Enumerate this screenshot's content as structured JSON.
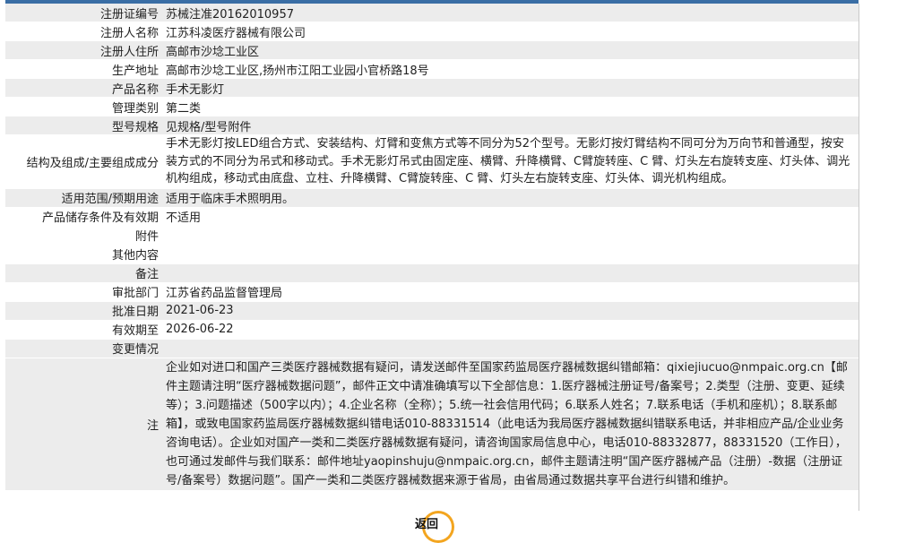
{
  "rows": [
    {
      "label": "注册证编号",
      "value": "苏械注准20162010957"
    },
    {
      "label": "注册人名称",
      "value": "江苏科凌医疗器械有限公司"
    },
    {
      "label": "注册人住所",
      "value": "高邮市沙埝工业区"
    },
    {
      "label": "生产地址",
      "value": "高邮市沙埝工业区,扬州市江阳工业园小官桥路18号"
    },
    {
      "label": "产品名称",
      "value": "手术无影灯"
    },
    {
      "label": "管理类别",
      "value": "第二类"
    },
    {
      "label": "型号规格",
      "value": "见规格/型号附件"
    },
    {
      "label": "结构及组成/主要组成成分",
      "value": "手术无影灯按LED组合方式、安装结构、灯臂和变焦方式等不同分为52个型号。无影灯按灯臂结构不同可分为万向节和普通型，按安装方式的不同分为吊式和移动式。手术无影灯吊式由固定座、横臂、升降横臂、C臂旋转座、C 臂、灯头左右旋转支座、灯头体、调光机构组成，移动式由底盘、立柱、升降横臂、C臂旋转座、C 臂、灯头左右旋转支座、灯头体、调光机构组成。"
    },
    {
      "label": "适用范围/预期用途",
      "value": "适用于临床手术照明用。"
    },
    {
      "label": "产品储存条件及有效期",
      "value": "不适用"
    },
    {
      "label": "附件",
      "value": ""
    },
    {
      "label": "其他内容",
      "value": ""
    },
    {
      "label": "备注",
      "value": ""
    },
    {
      "label": "审批部门",
      "value": "江苏省药品监督管理局"
    },
    {
      "label": "批准日期",
      "value": "2021-06-23"
    },
    {
      "label": "有效期至",
      "value": "2026-06-22"
    },
    {
      "label": "变更情况",
      "value": ""
    },
    {
      "label": "注",
      "value": "企业如对进口和国产三类医疗器械数据有疑问，请发送邮件至国家药监局医疗器械数据纠错邮箱：qixiejiucuo@nmpaic.org.cn【邮件主题请注明“医疗器械数据问题”，邮件正文中请准确填写以下全部信息：1.医疗器械注册证号/备案号；2.类型（注册、变更、延续等）；3.问题描述（500字以内）；4.企业名称（全称）；5.统一社会信用代码；6.联系人姓名；7.联系电话（手机和座机）；8.联系邮箱】，或致电国家药监局医疗器械数据纠错电话010-88331514（此电话为我局医疗器械数据纠错联系电话，并非相应产品/企业业务咨询电话）。企业如对国产一类和二类医疗器械数据有疑问，请咨询国家局信息中心，电话010-88332877，88331520（工作日），也可通过发邮件与我们联系：邮件地址yaopinshuju@nmpaic.org.cn，邮件主题请注明“国产医疗器械产品（注册）-数据（注册证号/备案号）数据问题”。国产一类和二类医疗器械数据来源于省局，由省局通过数据共享平台进行纠错和维护。"
    }
  ],
  "back_button": "返回"
}
